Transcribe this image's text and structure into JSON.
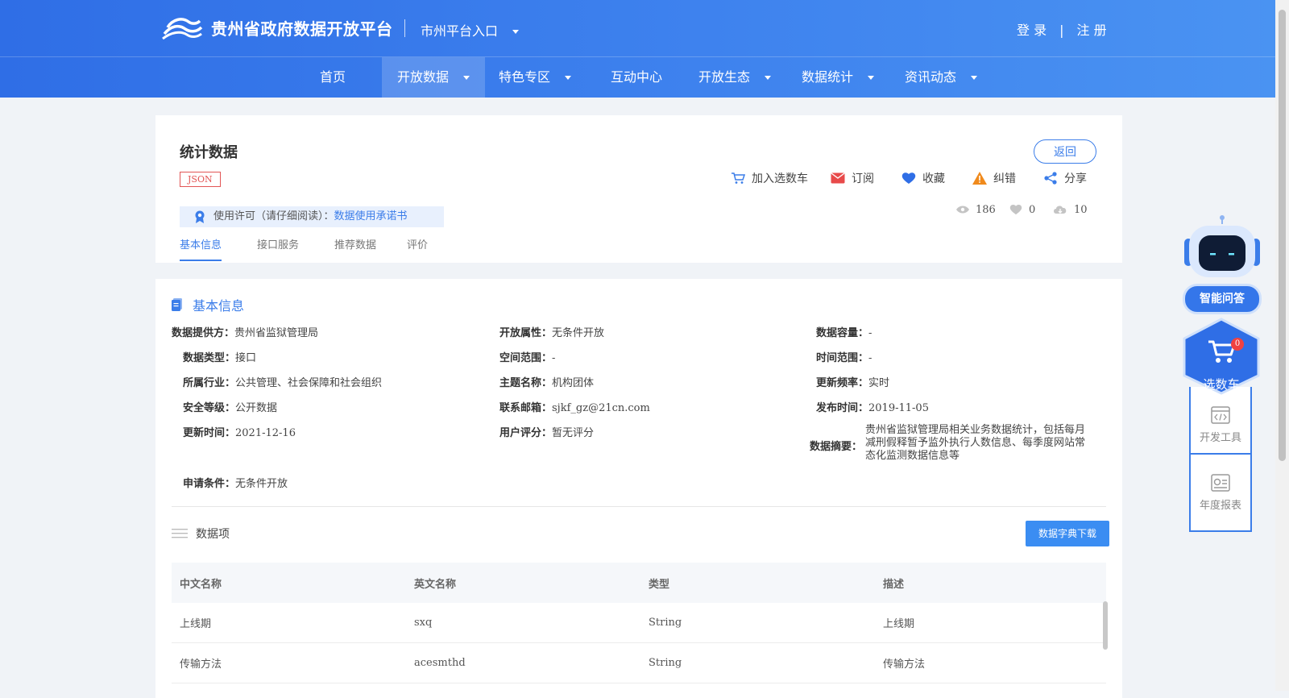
{
  "header": {
    "site_title": "贵州省政府数据开放平台",
    "city_entry": "市州平台入口",
    "login": "登 录",
    "auth_separator": "|",
    "register": "注 册"
  },
  "nav": {
    "items": [
      {
        "label": "首页"
      },
      {
        "label": "开放数据",
        "active": true
      },
      {
        "label": "特色专区"
      },
      {
        "label": "互动中心"
      },
      {
        "label": "开放生态"
      },
      {
        "label": "数据统计"
      },
      {
        "label": "资讯动态"
      }
    ]
  },
  "dataset": {
    "title": "统计数据",
    "format_badge": "JSON",
    "back_label": "返回",
    "actions": {
      "cart": "加入选数车",
      "subscribe": "订阅",
      "favorite": "收藏",
      "correct": "纠错",
      "share": "分享"
    },
    "license_label": "使用许可（请仔细阅读）：",
    "license_link": "数据使用承诺书",
    "stats": {
      "views": "186",
      "likes": "0",
      "downloads": "10"
    },
    "tabs": [
      "基本信息",
      "接口服务",
      "推荐数据",
      "评价"
    ]
  },
  "basic_info": {
    "section_title": "基本信息",
    "provider": {
      "label": "数据提供方：",
      "value": "贵州省监狱管理局"
    },
    "open_attr": {
      "label": "开放属性：",
      "value": "无条件开放"
    },
    "capacity": {
      "label": "数据容量：",
      "value": "-"
    },
    "data_type": {
      "label": "数据类型：",
      "value": "接口"
    },
    "space_range": {
      "label": "空间范围：",
      "value": "-"
    },
    "time_range": {
      "label": "时间范围：",
      "value": "-"
    },
    "industry": {
      "label": "所属行业：",
      "value": "公共管理、社会保障和社会组织"
    },
    "topic": {
      "label": "主题名称：",
      "value": "机构团体"
    },
    "frequency": {
      "label": "更新频率：",
      "value": "实时"
    },
    "security": {
      "label": "安全等级：",
      "value": "公开数据"
    },
    "email": {
      "label": "联系邮箱：",
      "value": "sjkf_gz@21cn.com"
    },
    "publish_time": {
      "label": "发布时间：",
      "value": "2019-11-05"
    },
    "update_time": {
      "label": "更新时间：",
      "value": "2021-12-16"
    },
    "rating": {
      "label": "用户评分：",
      "value": "暂无评分"
    },
    "summary": {
      "label": "数据摘要：",
      "value": "贵州省监狱管理局相关业务数据统计，包括每月减刑假释暂予监外执行人数信息、每季度网站常态化监测数据信息等"
    },
    "apply": {
      "label": "申请条件：",
      "value": "无条件开放"
    }
  },
  "data_items": {
    "title": "数据项",
    "download_label": "数据字典下载",
    "columns": [
      "中文名称",
      "英文名称",
      "类型",
      "描述"
    ],
    "rows": [
      [
        "上线期",
        "sxq",
        "String",
        "上线期"
      ],
      [
        "传输方法",
        "acesmthd",
        "String",
        "传输方法"
      ]
    ]
  },
  "sidebar": {
    "ai_label": "智能问答",
    "cart_label": "选数车",
    "cart_count": "0",
    "dev_tools": "开发工具",
    "annual_report": "年度报表"
  },
  "colors": {
    "primary": "#3b7de9",
    "header_start": "#2f6ee6",
    "header_end": "#4a93f2",
    "badge_red": "#e25555",
    "warning": "#f08a1c"
  }
}
